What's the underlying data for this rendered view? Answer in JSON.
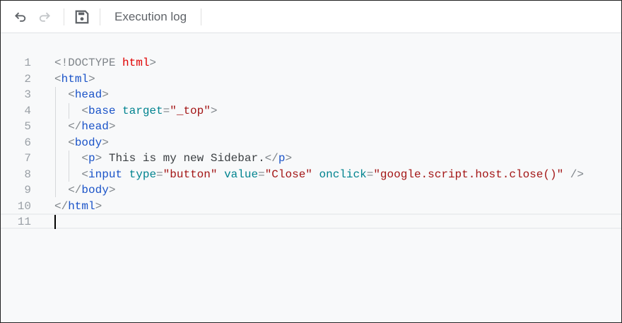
{
  "toolbar": {
    "undo_icon": "undo-icon",
    "redo_icon": "redo-icon",
    "save_icon": "save-icon",
    "execution_log_label": "Execution log"
  },
  "colors": {
    "bracket": "#80868b",
    "tag": "#1a53c8",
    "attr": "#00838f",
    "string": "#a31515",
    "keyword": "#e00000",
    "text": "#3c4043"
  },
  "editor": {
    "lines": [
      {
        "n": "1",
        "tokens": [
          {
            "t": "<!DOCTYPE ",
            "c": "bracket"
          },
          {
            "t": "html",
            "c": "keyword"
          },
          {
            "t": ">",
            "c": "bracket"
          }
        ]
      },
      {
        "n": "2",
        "tokens": [
          {
            "t": "<",
            "c": "bracket"
          },
          {
            "t": "html",
            "c": "tag"
          },
          {
            "t": ">",
            "c": "bracket"
          }
        ]
      },
      {
        "n": "3",
        "tokens": [
          {
            "t": "  <",
            "c": "bracket"
          },
          {
            "t": "head",
            "c": "tag"
          },
          {
            "t": ">",
            "c": "bracket"
          }
        ]
      },
      {
        "n": "4",
        "tokens": [
          {
            "t": "    <",
            "c": "bracket"
          },
          {
            "t": "base",
            "c": "tag"
          },
          {
            "t": " target",
            "c": "attr"
          },
          {
            "t": "=",
            "c": "bracket"
          },
          {
            "t": "\"_top\"",
            "c": "string"
          },
          {
            "t": ">",
            "c": "bracket"
          }
        ]
      },
      {
        "n": "5",
        "tokens": [
          {
            "t": "  </",
            "c": "bracket"
          },
          {
            "t": "head",
            "c": "tag"
          },
          {
            "t": ">",
            "c": "bracket"
          }
        ]
      },
      {
        "n": "6",
        "tokens": [
          {
            "t": "  <",
            "c": "bracket"
          },
          {
            "t": "body",
            "c": "tag"
          },
          {
            "t": ">",
            "c": "bracket"
          }
        ]
      },
      {
        "n": "7",
        "tokens": [
          {
            "t": "    <",
            "c": "bracket"
          },
          {
            "t": "p",
            "c": "tag"
          },
          {
            "t": ">",
            "c": "bracket"
          },
          {
            "t": " This is my new Sidebar.",
            "c": "text"
          },
          {
            "t": "</",
            "c": "bracket"
          },
          {
            "t": "p",
            "c": "tag"
          },
          {
            "t": ">",
            "c": "bracket"
          }
        ]
      },
      {
        "n": "8",
        "tokens": [
          {
            "t": "    <",
            "c": "bracket"
          },
          {
            "t": "input",
            "c": "tag"
          },
          {
            "t": " type",
            "c": "attr"
          },
          {
            "t": "=",
            "c": "bracket"
          },
          {
            "t": "\"button\"",
            "c": "string"
          },
          {
            "t": " value",
            "c": "attr"
          },
          {
            "t": "=",
            "c": "bracket"
          },
          {
            "t": "\"Close\"",
            "c": "string"
          },
          {
            "t": " onclick",
            "c": "attr"
          },
          {
            "t": "=",
            "c": "bracket"
          },
          {
            "t": "\"google.script.host.close()\"",
            "c": "string"
          },
          {
            "t": " />",
            "c": "bracket"
          }
        ]
      },
      {
        "n": "9",
        "tokens": [
          {
            "t": "  </",
            "c": "bracket"
          },
          {
            "t": "body",
            "c": "tag"
          },
          {
            "t": ">",
            "c": "bracket"
          }
        ]
      },
      {
        "n": "10",
        "tokens": [
          {
            "t": "</",
            "c": "bracket"
          },
          {
            "t": "html",
            "c": "tag"
          },
          {
            "t": ">",
            "c": "bracket"
          }
        ]
      },
      {
        "n": "11",
        "tokens": []
      }
    ]
  }
}
